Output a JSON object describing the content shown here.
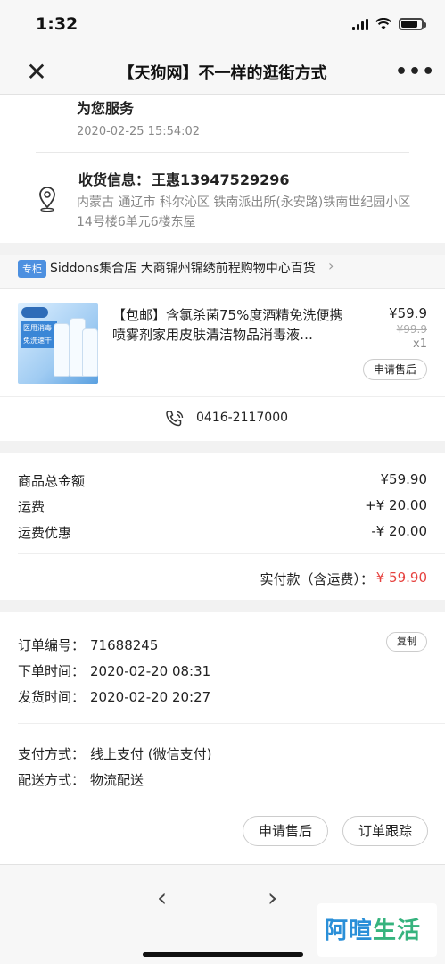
{
  "status_bar": {
    "time": "1:32"
  },
  "nav": {
    "title": "【天狗网】不一样的逛街方式",
    "more": "•••"
  },
  "address": {
    "service_text": "为您服务",
    "service_time": "2020-02-25 15:54:02",
    "recipient_label": "收货信息：",
    "recipient": "王惠13947529296",
    "address_line": "内蒙古 通辽市 科尔沁区 铁南派出所(永安路)铁南世纪园小区14号楼6单元6楼东屋"
  },
  "store": {
    "tag": "专柜",
    "name": "Siddons集合店  大商锦州锦绣前程购物中心百货"
  },
  "product": {
    "title": "【包邮】含氯杀菌75%度酒精免洗便携喷雾剂家用皮肤清洁物品消毒液…",
    "price": "¥59.9",
    "original_price": "¥99.9",
    "quantity": "x1",
    "refund_button": "申请售后",
    "phone": "0416-2117000",
    "image_lines": [
      "医用消毒",
      "免洗速干"
    ]
  },
  "summary": {
    "items_total_label": "商品总金额",
    "items_total": "¥59.90",
    "shipping_label": "运费",
    "shipping": "+¥ 20.00",
    "shipping_discount_label": "运费优惠",
    "shipping_discount": "-¥ 20.00",
    "paid_label": "实付款（含运费）：",
    "paid": "¥ 59.90"
  },
  "order_info": {
    "order_no_label": "订单编号：",
    "order_no": "71688245",
    "copy_button": "复制",
    "order_time_label": "下单时间：",
    "order_time": "2020-02-20 08:31",
    "ship_time_label": "发货时间：",
    "ship_time": "2020-02-20 20:27",
    "payment_label": "支付方式：",
    "payment": "线上支付 (微信支付)",
    "delivery_label": "配送方式：",
    "delivery": "物流配送",
    "refund_button": "申请售后",
    "track_button": "订单跟踪"
  },
  "watermark": {
    "highlight": "阿暄",
    "text": "生活"
  },
  "colors": {
    "accent_red": "#e64340",
    "tag_blue": "#4d90e0",
    "watermark_green": "#36b37e"
  }
}
